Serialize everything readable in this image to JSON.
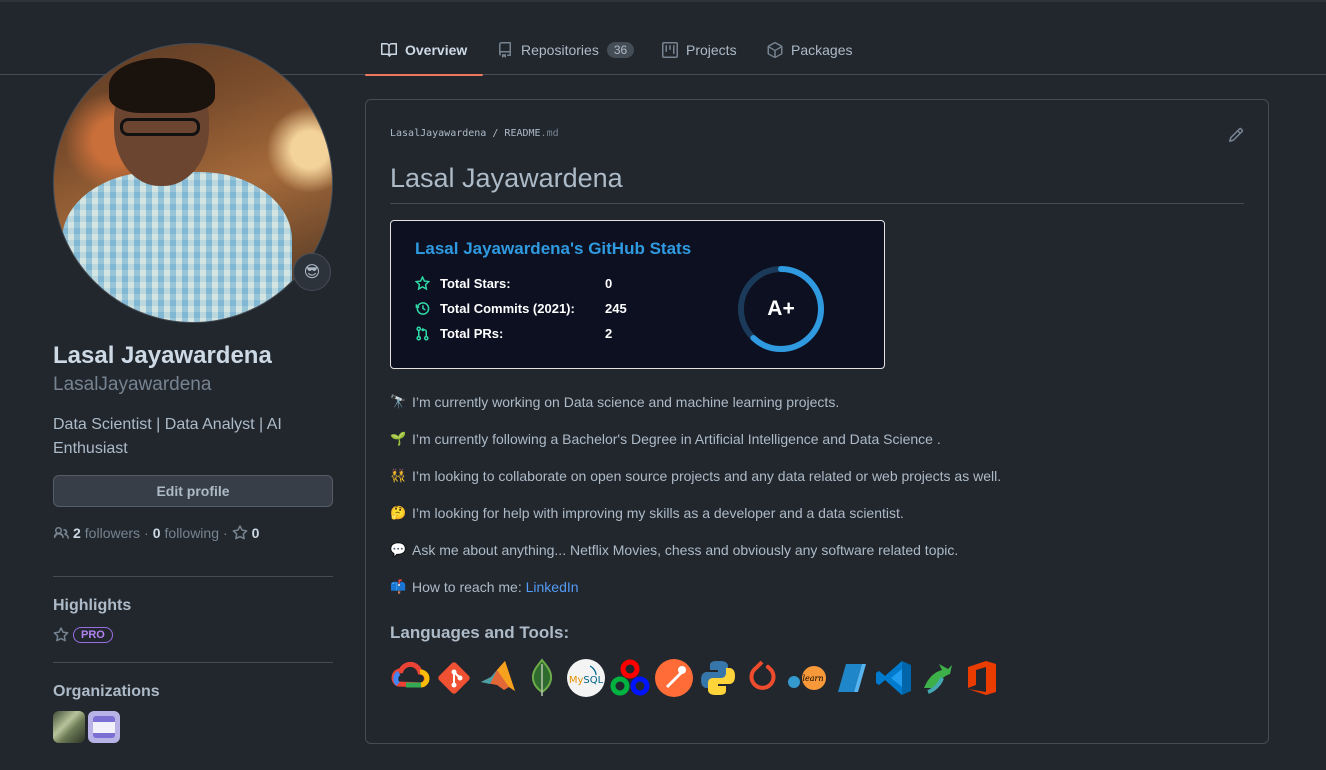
{
  "tabs": [
    {
      "label": "Overview",
      "icon": "book-icon",
      "active": true
    },
    {
      "label": "Repositories",
      "icon": "repo-icon",
      "count": "36"
    },
    {
      "label": "Projects",
      "icon": "project-icon"
    },
    {
      "label": "Packages",
      "icon": "package-icon"
    }
  ],
  "profile": {
    "full_name": "Lasal Jayawardena",
    "username": "LasalJayawardena",
    "status_emoji": "😎",
    "bio": "Data Scientist | Data Analyst | AI Enthusiast",
    "edit_label": "Edit profile",
    "followers_count": "2",
    "followers_label": "followers",
    "following_count": "0",
    "following_label": "following",
    "stars_count": "0",
    "sep": "·"
  },
  "highlights": {
    "title": "Highlights",
    "badge": "PRO"
  },
  "organizations": {
    "title": "Organizations"
  },
  "readme": {
    "crumb_user": "LasalJayawardena",
    "crumb_sep": "/",
    "crumb_file": "README",
    "crumb_ext": ".md",
    "title": "Lasal Jayawardena",
    "stats": {
      "title": "Lasal Jayawardena's GitHub Stats",
      "rows": [
        {
          "label": "Total Stars:",
          "value": "0",
          "icon": "star-icon"
        },
        {
          "label": "Total Commits (2021):",
          "value": "245",
          "icon": "history-icon"
        },
        {
          "label": "Total PRs:",
          "value": "2",
          "icon": "pull-request-icon"
        }
      ],
      "grade": "A+",
      "grade_progress": 0.62,
      "accent": "#2f9ae0",
      "icon_color": "#30d9a5"
    },
    "bullets": [
      {
        "emoji": "🔭",
        "text": "I’m currently working on Data science and machine learning projects."
      },
      {
        "emoji": "🌱",
        "text": "I’m currently following a Bachelor's Degree in Artificial Intelligence and Data Science ."
      },
      {
        "emoji": "👯",
        "text": "I’m looking to collaborate on open source projects and any data related or web projects as well."
      },
      {
        "emoji": "🤔",
        "text": "I’m looking for help with improving my skills as a developer and a data scientist."
      },
      {
        "emoji": "💬",
        "text": "Ask me about anything... Netflix Movies, chess and obviously any software related topic."
      },
      {
        "emoji": "📫",
        "text": "How to reach me: ",
        "link": "LinkedIn"
      }
    ],
    "tools_title": "Languages and Tools:",
    "tools": [
      "gcp-icon",
      "git-icon",
      "matlab-icon",
      "mongodb-icon",
      "mysql-icon",
      "opencv-icon",
      "postman-icon",
      "python-icon",
      "pytorch-icon",
      "scikit-learn-icon",
      "power-bi-icon",
      "vscode-icon",
      "anaconda-icon",
      "office-icon"
    ]
  }
}
